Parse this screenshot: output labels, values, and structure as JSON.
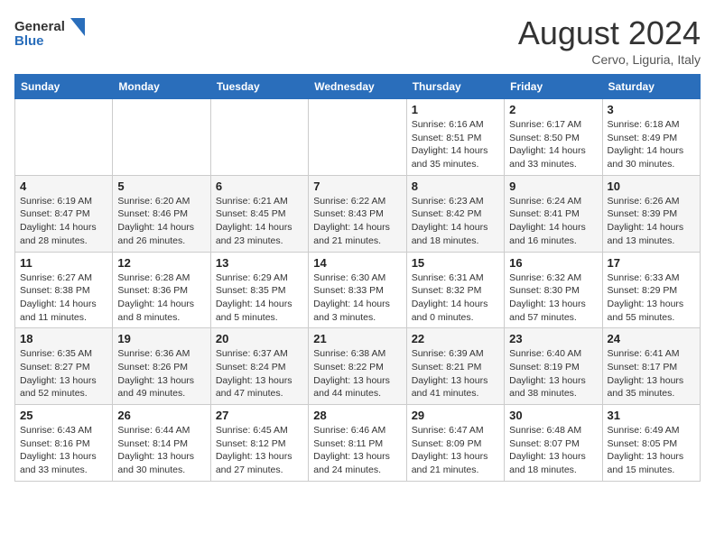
{
  "header": {
    "logo_general": "General",
    "logo_blue": "Blue",
    "month_year": "August 2024",
    "location": "Cervo, Liguria, Italy"
  },
  "weekdays": [
    "Sunday",
    "Monday",
    "Tuesday",
    "Wednesday",
    "Thursday",
    "Friday",
    "Saturday"
  ],
  "weeks": [
    [
      {
        "day": "",
        "info": ""
      },
      {
        "day": "",
        "info": ""
      },
      {
        "day": "",
        "info": ""
      },
      {
        "day": "",
        "info": ""
      },
      {
        "day": "1",
        "info": "Sunrise: 6:16 AM\nSunset: 8:51 PM\nDaylight: 14 hours\nand 35 minutes."
      },
      {
        "day": "2",
        "info": "Sunrise: 6:17 AM\nSunset: 8:50 PM\nDaylight: 14 hours\nand 33 minutes."
      },
      {
        "day": "3",
        "info": "Sunrise: 6:18 AM\nSunset: 8:49 PM\nDaylight: 14 hours\nand 30 minutes."
      }
    ],
    [
      {
        "day": "4",
        "info": "Sunrise: 6:19 AM\nSunset: 8:47 PM\nDaylight: 14 hours\nand 28 minutes."
      },
      {
        "day": "5",
        "info": "Sunrise: 6:20 AM\nSunset: 8:46 PM\nDaylight: 14 hours\nand 26 minutes."
      },
      {
        "day": "6",
        "info": "Sunrise: 6:21 AM\nSunset: 8:45 PM\nDaylight: 14 hours\nand 23 minutes."
      },
      {
        "day": "7",
        "info": "Sunrise: 6:22 AM\nSunset: 8:43 PM\nDaylight: 14 hours\nand 21 minutes."
      },
      {
        "day": "8",
        "info": "Sunrise: 6:23 AM\nSunset: 8:42 PM\nDaylight: 14 hours\nand 18 minutes."
      },
      {
        "day": "9",
        "info": "Sunrise: 6:24 AM\nSunset: 8:41 PM\nDaylight: 14 hours\nand 16 minutes."
      },
      {
        "day": "10",
        "info": "Sunrise: 6:26 AM\nSunset: 8:39 PM\nDaylight: 14 hours\nand 13 minutes."
      }
    ],
    [
      {
        "day": "11",
        "info": "Sunrise: 6:27 AM\nSunset: 8:38 PM\nDaylight: 14 hours\nand 11 minutes."
      },
      {
        "day": "12",
        "info": "Sunrise: 6:28 AM\nSunset: 8:36 PM\nDaylight: 14 hours\nand 8 minutes."
      },
      {
        "day": "13",
        "info": "Sunrise: 6:29 AM\nSunset: 8:35 PM\nDaylight: 14 hours\nand 5 minutes."
      },
      {
        "day": "14",
        "info": "Sunrise: 6:30 AM\nSunset: 8:33 PM\nDaylight: 14 hours\nand 3 minutes."
      },
      {
        "day": "15",
        "info": "Sunrise: 6:31 AM\nSunset: 8:32 PM\nDaylight: 14 hours\nand 0 minutes."
      },
      {
        "day": "16",
        "info": "Sunrise: 6:32 AM\nSunset: 8:30 PM\nDaylight: 13 hours\nand 57 minutes."
      },
      {
        "day": "17",
        "info": "Sunrise: 6:33 AM\nSunset: 8:29 PM\nDaylight: 13 hours\nand 55 minutes."
      }
    ],
    [
      {
        "day": "18",
        "info": "Sunrise: 6:35 AM\nSunset: 8:27 PM\nDaylight: 13 hours\nand 52 minutes."
      },
      {
        "day": "19",
        "info": "Sunrise: 6:36 AM\nSunset: 8:26 PM\nDaylight: 13 hours\nand 49 minutes."
      },
      {
        "day": "20",
        "info": "Sunrise: 6:37 AM\nSunset: 8:24 PM\nDaylight: 13 hours\nand 47 minutes."
      },
      {
        "day": "21",
        "info": "Sunrise: 6:38 AM\nSunset: 8:22 PM\nDaylight: 13 hours\nand 44 minutes."
      },
      {
        "day": "22",
        "info": "Sunrise: 6:39 AM\nSunset: 8:21 PM\nDaylight: 13 hours\nand 41 minutes."
      },
      {
        "day": "23",
        "info": "Sunrise: 6:40 AM\nSunset: 8:19 PM\nDaylight: 13 hours\nand 38 minutes."
      },
      {
        "day": "24",
        "info": "Sunrise: 6:41 AM\nSunset: 8:17 PM\nDaylight: 13 hours\nand 35 minutes."
      }
    ],
    [
      {
        "day": "25",
        "info": "Sunrise: 6:43 AM\nSunset: 8:16 PM\nDaylight: 13 hours\nand 33 minutes."
      },
      {
        "day": "26",
        "info": "Sunrise: 6:44 AM\nSunset: 8:14 PM\nDaylight: 13 hours\nand 30 minutes."
      },
      {
        "day": "27",
        "info": "Sunrise: 6:45 AM\nSunset: 8:12 PM\nDaylight: 13 hours\nand 27 minutes."
      },
      {
        "day": "28",
        "info": "Sunrise: 6:46 AM\nSunset: 8:11 PM\nDaylight: 13 hours\nand 24 minutes."
      },
      {
        "day": "29",
        "info": "Sunrise: 6:47 AM\nSunset: 8:09 PM\nDaylight: 13 hours\nand 21 minutes."
      },
      {
        "day": "30",
        "info": "Sunrise: 6:48 AM\nSunset: 8:07 PM\nDaylight: 13 hours\nand 18 minutes."
      },
      {
        "day": "31",
        "info": "Sunrise: 6:49 AM\nSunset: 8:05 PM\nDaylight: 13 hours\nand 15 minutes."
      }
    ]
  ]
}
